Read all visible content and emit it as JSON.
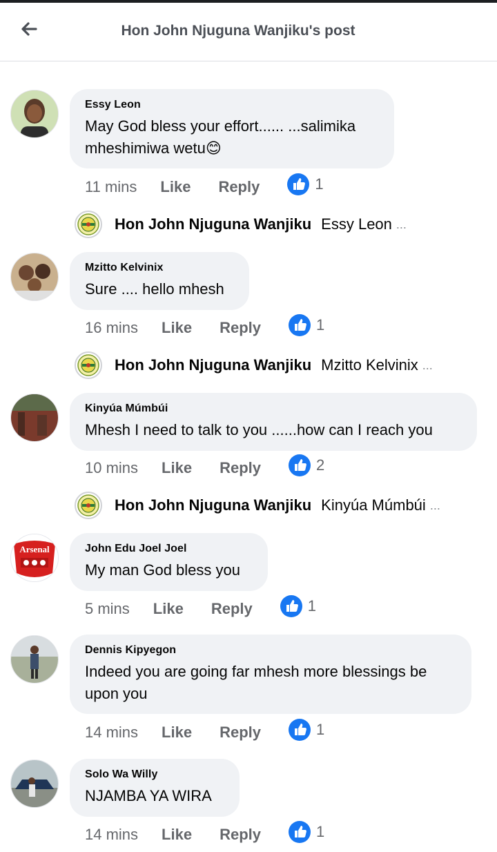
{
  "header": {
    "title": "Hon John Njuguna Wanjiku's post"
  },
  "actions": {
    "like": "Like",
    "reply": "Reply"
  },
  "comments": [
    {
      "author": "Essy Leon",
      "text": "May God bless your effort...... ...salimika mheshimiwa wetu😊",
      "time": "11 mins",
      "reactions": "1",
      "reply": {
        "author": "Hon John Njuguna Wanjiku",
        "snippet": "Essy Leon",
        "more": "..."
      }
    },
    {
      "author": "Mzitto Kelvinix",
      "text": "Sure .... hello mhesh",
      "time": "16 mins",
      "reactions": "1",
      "reply": {
        "author": "Hon John Njuguna Wanjiku",
        "snippet": "Mzitto Kelvinix",
        "more": "..."
      }
    },
    {
      "author": "Kinyúa Múmbúi",
      "text": "Mhesh I need to talk to you ......how can I reach you",
      "time": "10 mins",
      "reactions": "2",
      "reply": {
        "author": "Hon John Njuguna Wanjiku",
        "snippet": "Kinyúa Múmbúi",
        "more": "..."
      }
    },
    {
      "author": "John Edu Joel Joel",
      "text": "My man God bless you",
      "time": "5 mins",
      "reactions": "1",
      "avatar_text": "Arsenal"
    },
    {
      "author": "Dennis Kipyegon",
      "text": "Indeed you are going far mhesh more blessings be upon you",
      "time": "14 mins",
      "reactions": "1"
    },
    {
      "author": "Solo Wa Willy",
      "text": "NJAMBA YA WIRA",
      "time": "14 mins",
      "reactions": "1"
    }
  ],
  "colors": {
    "like_blue": "#1877f2",
    "bubble": "#f0f2f5",
    "meta_gray": "#65676b",
    "header_text": "#4b4f56"
  },
  "icons": {
    "back": "arrow-left-icon",
    "like": "thumbs-up-icon"
  }
}
